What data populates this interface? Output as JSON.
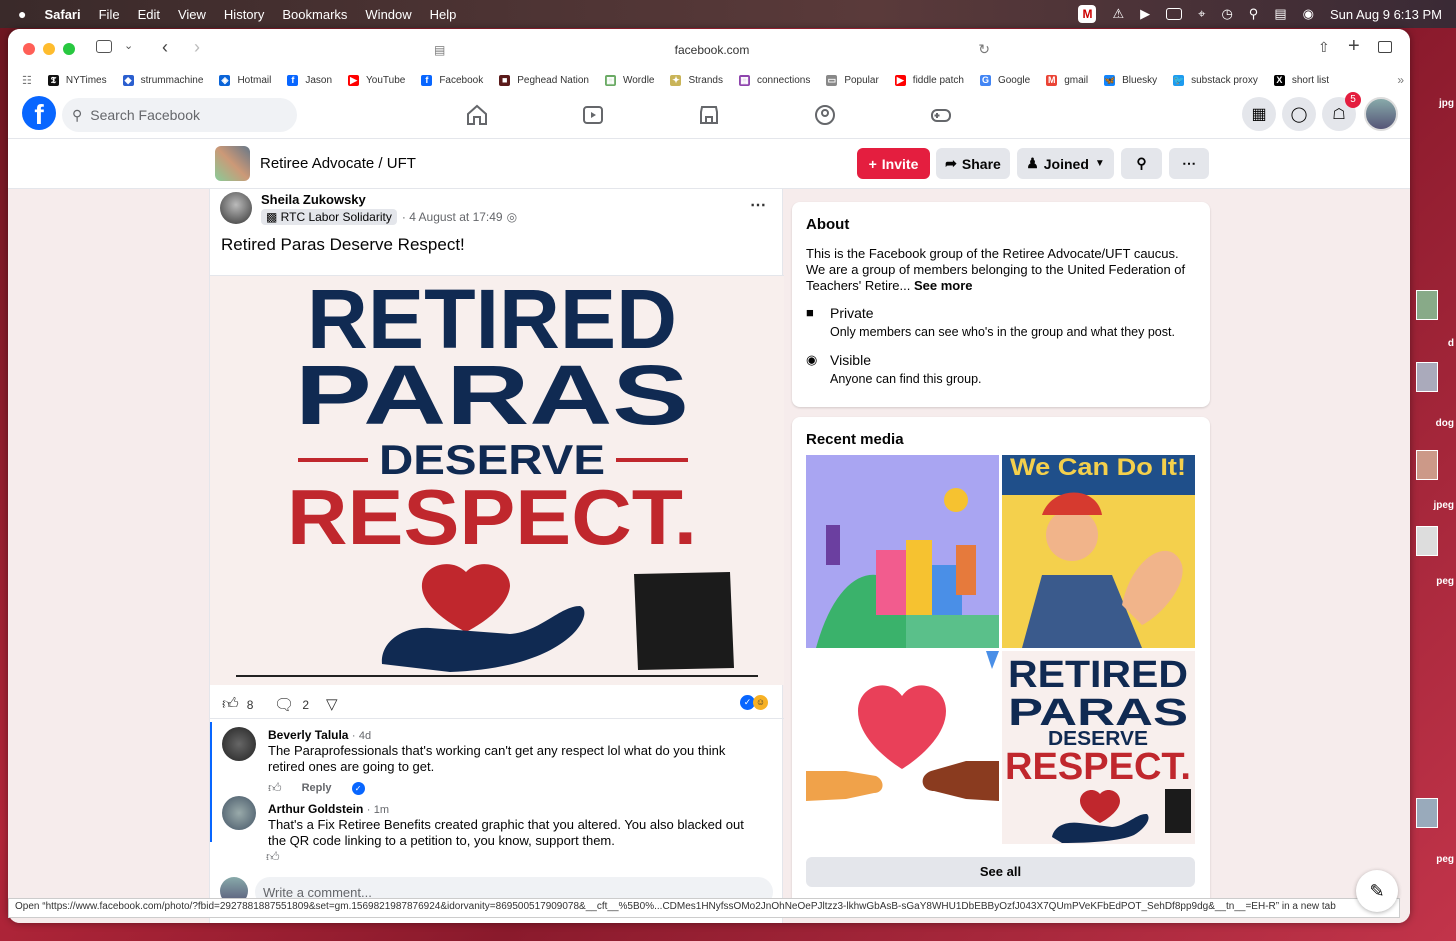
{
  "menubar": {
    "apple": "",
    "app": "Safari",
    "items": [
      "File",
      "Edit",
      "View",
      "History",
      "Bookmarks",
      "Window",
      "Help"
    ],
    "datetime": "Sun Aug 9  6:13 PM"
  },
  "desktop": {
    "labels": [
      "jpg",
      "d",
      "dog",
      "jpeg",
      "peg",
      "peg"
    ]
  },
  "browser": {
    "url": "facebook.com",
    "bookmarks": [
      {
        "label": "NYTimes",
        "icon": "nyt-icon",
        "color": "#111111",
        "glyph": "𝕿"
      },
      {
        "label": "strummachine",
        "icon": "shield-icon",
        "color": "#2b5fcf",
        "glyph": "◆"
      },
      {
        "label": "Hotmail",
        "icon": "outlook-icon",
        "color": "#0a64d8",
        "glyph": "◈"
      },
      {
        "label": "Jason",
        "icon": "facebook-icon",
        "color": "#0866ff",
        "glyph": "f"
      },
      {
        "label": "YouTube",
        "icon": "youtube-icon",
        "color": "#ff0000",
        "glyph": "▶"
      },
      {
        "label": "Facebook",
        "icon": "facebook-icon",
        "color": "#0866ff",
        "glyph": "f"
      },
      {
        "label": "Peghead Nation",
        "icon": "peghead-icon",
        "color": "#5a1a1a",
        "glyph": "■"
      },
      {
        "label": "Wordle",
        "icon": "wordle-icon",
        "color": "#6aaa64",
        "glyph": "▦"
      },
      {
        "label": "Strands",
        "icon": "strands-icon",
        "color": "#c9b458",
        "glyph": "✦"
      },
      {
        "label": "connections",
        "icon": "connections-icon",
        "color": "#8e44ad",
        "glyph": "▦"
      },
      {
        "label": "Popular",
        "icon": "folder-icon",
        "color": "#888888",
        "glyph": "▭"
      },
      {
        "label": "fiddle patch",
        "icon": "youtube-icon",
        "color": "#ff0000",
        "glyph": "▶"
      },
      {
        "label": "Google",
        "icon": "google-icon",
        "color": "#4285f4",
        "glyph": "G"
      },
      {
        "label": "gmail",
        "icon": "gmail-icon",
        "color": "#ea4335",
        "glyph": "M"
      },
      {
        "label": "Bluesky",
        "icon": "bluesky-icon",
        "color": "#1185fe",
        "glyph": "🦋"
      },
      {
        "label": "substack proxy",
        "icon": "twitter-icon",
        "color": "#1d9bf0",
        "glyph": "🐦"
      },
      {
        "label": "short list",
        "icon": "x-icon",
        "color": "#000000",
        "glyph": "X"
      }
    ],
    "status_url": "Open “https://www.facebook.com/photo/?fbid=2927881887551809&set=gm.1569821987876924&idorvanity=869500517909078&__cft__%5B0%...CDMes1HNyfssOMo2JnOhNeOePJltzz3-lkhwGbAsB-sGaY8WHU1DbEBByOzfJ043X7QUmPVeKFbEdPOT_SehDf8pp9dg&__tn__=EH-R” in a new tab"
  },
  "facebook": {
    "search_placeholder": "Search Facebook",
    "notification_count": "5",
    "group": {
      "name": "Retiree Advocate / UFT",
      "invite_label": "Invite",
      "share_label": "Share",
      "joined_label": "Joined"
    },
    "post": {
      "author": "Sheila Zukowsky",
      "source_group": "RTC Labor Solidarity",
      "time": "4 August at 17:49",
      "text": "Retired Paras Deserve Respect!",
      "image_text": {
        "line1": "RETIRED",
        "line2": "PARAS",
        "line3": "DESERVE",
        "line4": "RESPECT."
      },
      "likes": "8",
      "comments_count": "2"
    },
    "comments": [
      {
        "name": "Beverly Talula",
        "time": "4d",
        "text": "The Paraprofessionals that's working can't get any respect lol what do you think retired ones are going to get.",
        "reply": "Reply"
      },
      {
        "name": "Arthur Goldstein",
        "time": "1m",
        "text": "That's a Fix Retiree Benefits created graphic that you altered. You also blacked out the QR code linking to a petition to, you know, support them."
      }
    ],
    "write_comment_placeholder": "Write a comment...",
    "about": {
      "title": "About",
      "description": "This is the Facebook group of the Retiree Advocate/UFT caucus. We are a group of members belonging to the United Federation of Teachers' Retire...",
      "see_more": "See more",
      "private_title": "Private",
      "private_desc": "Only members can see who's in the group and what they post.",
      "visible_title": "Visible",
      "visible_desc": "Anyone can find this group."
    },
    "recent_media": {
      "title": "Recent media",
      "rosie_text": "We Can Do It!",
      "see_all": "See all"
    }
  },
  "colors": {
    "fb_blue": "#0866ff",
    "invite_red": "#e41e3f",
    "navy": "#102a52",
    "respect_red": "#c0272d"
  }
}
